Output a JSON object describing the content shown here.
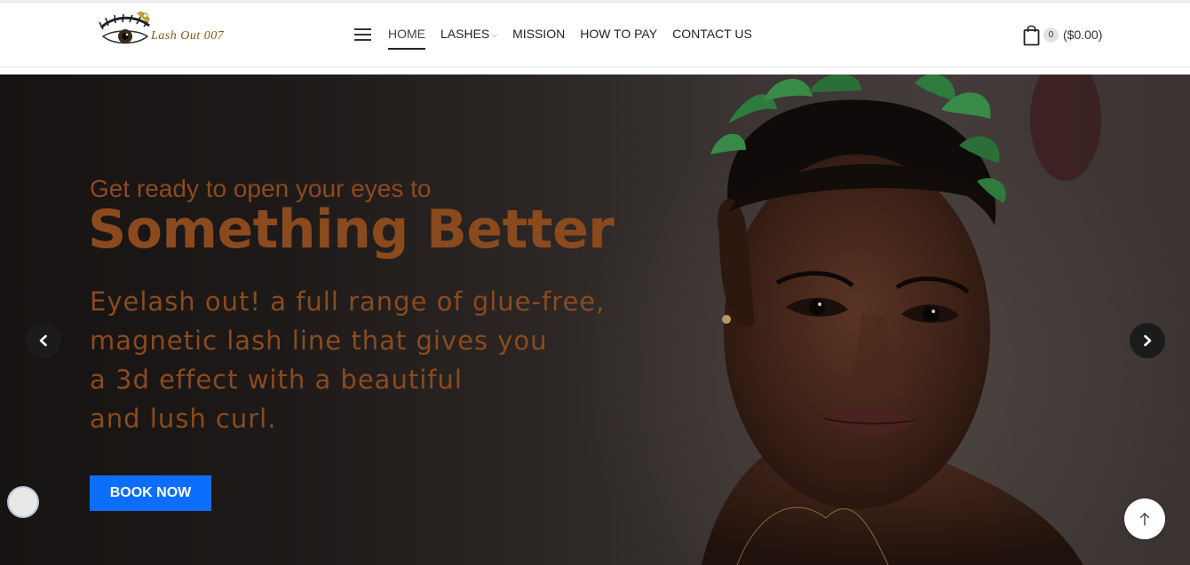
{
  "header": {
    "logo_text": "Lash Out 007",
    "nav": [
      {
        "label": "HOME",
        "active": true
      },
      {
        "label": "LASHES",
        "has_dropdown": true
      },
      {
        "label": "MISSION"
      },
      {
        "label": "HOW TO PAY"
      },
      {
        "label": "CONTACT US"
      }
    ],
    "dropdown_glyph": "⌵",
    "cart": {
      "count": "0",
      "total": "($0.00)",
      "icon": "shopping-bag-icon"
    }
  },
  "hero": {
    "pre_title": "Get ready to open your eyes to",
    "title": "Something Better",
    "description_lines": [
      "Eyelash out! a full range of glue-free,",
      "magnetic lash line that gives you",
      "a 3d effect with a beautiful",
      "and lush curl."
    ],
    "cta_label": "BOOK NOW",
    "prev_icon": "chevron-left-icon",
    "next_icon": "chevron-right-icon"
  },
  "colors": {
    "accent_text": "#8b4a1e",
    "button": "#0d6efd",
    "hero_bg": "#2b2624"
  },
  "scroll_top_icon": "arrow-up-icon"
}
